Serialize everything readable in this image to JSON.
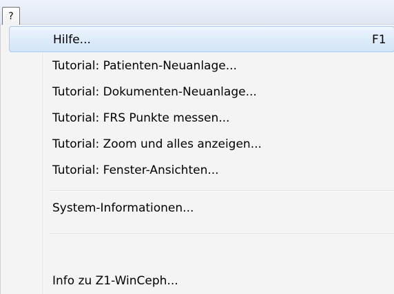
{
  "menubar": {
    "help_menu_label": "?"
  },
  "menu": {
    "items": [
      {
        "label": "Hilfe...",
        "shortcut": "F1"
      },
      {
        "label": "Tutorial: Patienten-Neuanlage..."
      },
      {
        "label": "Tutorial: Dokumenten-Neuanlage..."
      },
      {
        "label": "Tutorial: FRS Punkte messen..."
      },
      {
        "label": "Tutorial: Zoom und alles anzeigen..."
      },
      {
        "label": "Tutorial: Fenster-Ansichten..."
      },
      {
        "label": "System-Informationen..."
      },
      {
        "label": "Info zu Z1-WinCeph..."
      }
    ]
  },
  "colors": {
    "highlight_border": "#a8cbf0",
    "highlight_fill": "#dbeaf9",
    "menu_background": "#f4f4f4"
  }
}
